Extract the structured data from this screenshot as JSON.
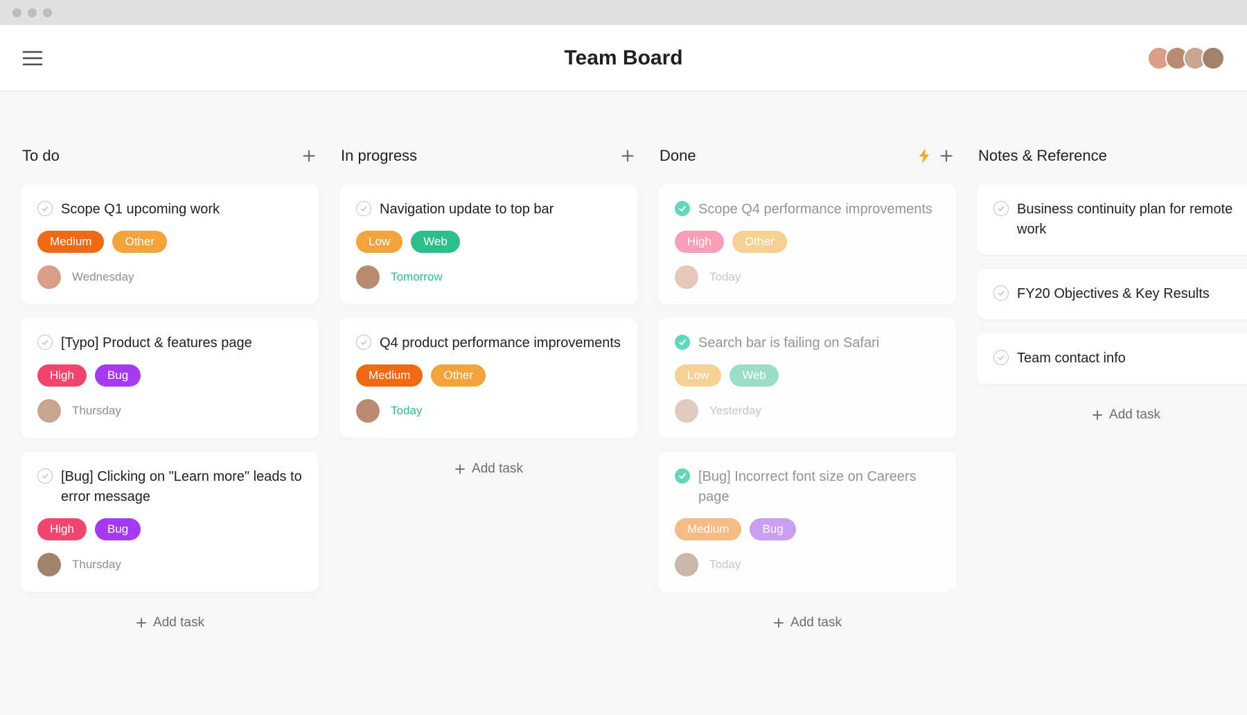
{
  "header": {
    "title": "Team Board"
  },
  "add_task_label": "Add task",
  "columns": [
    {
      "title": "To do",
      "show_bolt": false,
      "show_plus": true,
      "show_add_task": true,
      "cards": [
        {
          "title": "Scope Q1 upcoming work",
          "complete": false,
          "tags": [
            {
              "label": "Medium",
              "cls": "tag-medium-solid"
            },
            {
              "label": "Other",
              "cls": "tag-other"
            }
          ],
          "avatar_cls": "av1",
          "due": "Wednesday",
          "due_green": false
        },
        {
          "title": "[Typo] Product & features page",
          "complete": false,
          "tags": [
            {
              "label": "High",
              "cls": "tag-high"
            },
            {
              "label": "Bug",
              "cls": "tag-bug"
            }
          ],
          "avatar_cls": "av3",
          "due": "Thursday",
          "due_green": false
        },
        {
          "title": "[Bug] Clicking on \"Learn more\" leads to error message",
          "complete": false,
          "tags": [
            {
              "label": "High",
              "cls": "tag-high"
            },
            {
              "label": "Bug",
              "cls": "tag-bug"
            }
          ],
          "avatar_cls": "av4",
          "due": "Thursday",
          "due_green": false
        }
      ]
    },
    {
      "title": "In progress",
      "show_bolt": false,
      "show_plus": true,
      "show_add_task": true,
      "cards": [
        {
          "title": "Navigation update to top bar",
          "complete": false,
          "tags": [
            {
              "label": "Low",
              "cls": "tag-low"
            },
            {
              "label": "Web",
              "cls": "tag-web"
            }
          ],
          "avatar_cls": "av2",
          "due": "Tomorrow",
          "due_green": true
        },
        {
          "title": "Q4 product performance improvements",
          "complete": false,
          "tags": [
            {
              "label": "Medium",
              "cls": "tag-medium-solid"
            },
            {
              "label": "Other",
              "cls": "tag-other"
            }
          ],
          "avatar_cls": "av2",
          "due": "Today",
          "due_green": true
        }
      ]
    },
    {
      "title": "Done",
      "show_bolt": true,
      "show_plus": true,
      "show_add_task": true,
      "cards": [
        {
          "title": "Scope Q4 performance improvements",
          "complete": true,
          "tags": [
            {
              "label": "High",
              "cls": "tag-high"
            },
            {
              "label": "Other",
              "cls": "tag-other"
            }
          ],
          "avatar_cls": "av1 avm",
          "due": "Today",
          "due_green": false
        },
        {
          "title": "Search bar is failing on Safari",
          "complete": true,
          "tags": [
            {
              "label": "Low",
              "cls": "tag-low"
            },
            {
              "label": "Web",
              "cls": "tag-web"
            }
          ],
          "avatar_cls": "av3 avm",
          "due": "Yesterday",
          "due_green": false
        },
        {
          "title": "[Bug] Incorrect font size on Careers page",
          "complete": true,
          "tags": [
            {
              "label": "Medium",
              "cls": "tag-medium"
            },
            {
              "label": "Bug",
              "cls": "tag-bug"
            }
          ],
          "avatar_cls": "av4 avm",
          "due": "Today",
          "due_green": false
        }
      ]
    },
    {
      "title": "Notes & Reference",
      "show_bolt": false,
      "show_plus": false,
      "show_add_task": true,
      "cards": [
        {
          "title": "Business continuity plan for remote work",
          "complete": false,
          "tags": [],
          "avatar_cls": null,
          "due": null
        },
        {
          "title": "FY20 Objectives & Key Results",
          "complete": false,
          "tags": [],
          "avatar_cls": null,
          "due": null
        },
        {
          "title": "Team contact info",
          "complete": false,
          "tags": [],
          "avatar_cls": null,
          "due": null
        }
      ]
    }
  ]
}
